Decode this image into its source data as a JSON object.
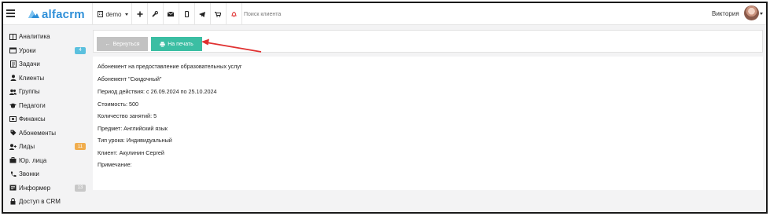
{
  "topbar": {
    "logo_text": "alfacrm",
    "branch": "demo",
    "search_placeholder": "Поиск клиента",
    "user_name": "Виктория",
    "icons": [
      "plus-icon",
      "wrench-icon",
      "envelope-icon",
      "mobile-icon",
      "telegram-icon",
      "cart-icon",
      "bell-icon"
    ]
  },
  "sidebar": {
    "items": [
      {
        "label": "Аналитика",
        "icon": "analytics-icon"
      },
      {
        "label": "Уроки",
        "icon": "calendar-icon",
        "badge": "4",
        "badge_color": "#5bc0de"
      },
      {
        "label": "Задачи",
        "icon": "tasks-icon"
      },
      {
        "label": "Клиенты",
        "icon": "user-icon"
      },
      {
        "label": "Группы",
        "icon": "users-icon"
      },
      {
        "label": "Педагоги",
        "icon": "graduation-cap-icon"
      },
      {
        "label": "Финансы",
        "icon": "money-icon"
      },
      {
        "label": "Абонементы",
        "icon": "tag-icon"
      },
      {
        "label": "Лиды",
        "icon": "user-plus-icon",
        "badge": "11",
        "badge_color": "#f0ad4e"
      },
      {
        "label": "Юр. лица",
        "icon": "briefcase-icon"
      },
      {
        "label": "Звонки",
        "icon": "phone-icon"
      },
      {
        "label": "Информер",
        "icon": "newspaper-icon",
        "badge": "13",
        "badge_color": "#c8c8c8"
      },
      {
        "label": "Доступ в CRM",
        "icon": "lock-icon"
      }
    ]
  },
  "actions": {
    "back_label": "Вернуться",
    "print_label": "На печать"
  },
  "content": {
    "lines": [
      "Абонемент на предоставление образовательных услуг",
      "Абонемент \"Скидочный\"",
      "Период действия: с 26.09.2024 по 25.10.2024",
      "Стоимость: 500",
      "Количество занятий: 5",
      "Предмет: Английский язык",
      "Тип урока: Индивидуальный",
      "Клиент: Акулинин Сергей",
      "Примечание:"
    ]
  },
  "colors": {
    "accent": "#1ab394",
    "logo": "#2e8fd8",
    "arrow": "#e03131"
  }
}
